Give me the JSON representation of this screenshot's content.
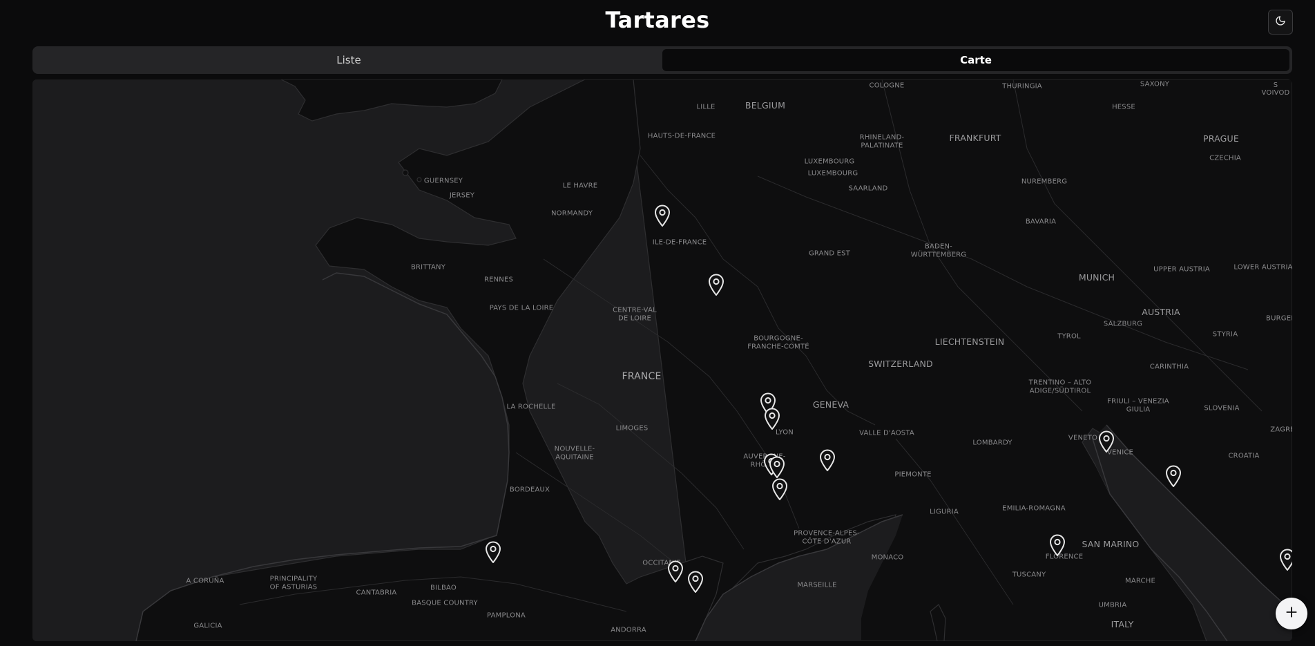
{
  "app": {
    "title": "Tartares"
  },
  "header": {
    "theme_toggle_icon": "moon-icon"
  },
  "tabs": [
    {
      "label": "Liste",
      "active": false
    },
    {
      "label": "Carte",
      "active": true
    }
  ],
  "map": {
    "labels": {
      "cologne": "COLOGNE",
      "thuringia": "THURINGIA",
      "saxony": "SAXONY",
      "lower_saxony": "LOWER S\nVOIVOD",
      "belgium": "BELGIUM",
      "lille": "LILLE",
      "hesse": "HESSE",
      "rhineland_palatinate": "RHINELAND-\nPALATINATE",
      "frankfurt": "FRANKFURT",
      "prague": "PRAGUE",
      "czechia": "CZECHIA",
      "hauts_de_france": "HAUTS-DE-FRANCE",
      "luxembourg_country": "LUXEMBOURG",
      "luxembourg_city": "LUXEMBOURG",
      "saarland": "SAARLAND",
      "nuremberg": "NUREMBERG",
      "guernsey": "GUERNSEY",
      "jersey": "JERSEY",
      "le_havre": "LE HAVRE",
      "normandy": "NORMANDY",
      "bavaria": "BAVARIA",
      "ile_de_france": "ILE-DE-FRANCE",
      "baden_wurttemberg": "BADEN-\nWÜRTTEMBERG",
      "grand_est": "GRAND EST",
      "brittany": "BRITTANY",
      "munich": "MUNICH",
      "upper_austria": "UPPER AUSTRIA",
      "lower_austria": "LOWER AUSTRIA",
      "rennes": "RENNES",
      "pays_de_la_loire": "PAYS DE LA LOIRE",
      "centre_val_de_loire": "CENTRE-VAL\nDE LOIRE",
      "austria": "AUSTRIA",
      "salzburg": "SALZBURG",
      "burgenland": "BURGEN",
      "bourgogne": "BOURGOGNE-\nFRANCHE-COMTÉ",
      "liechtenstein": "LIECHTENSTEIN",
      "tyrol": "TYROL",
      "styria": "STYRIA",
      "switzerland": "SWITZERLAND",
      "carinthia": "CARINTHIA",
      "france": "FRANCE",
      "trentino": "TRENTINO – ALTO\nADIGE/SÜDTIROL",
      "la_rochelle": "LA ROCHELLE",
      "geneva": "GENEVA",
      "friuli": "FRIULI – VENEZIA\nGIULIA",
      "slovenia": "SLOVENIA",
      "limoges": "LIMOGES",
      "lyon": "LYON",
      "valle_d_aosta": "VALLE D'AOSTA",
      "zagreb": "ZAGRE",
      "veneto": "VENETO",
      "venice": "VENICE",
      "nouvelle_aquitaine": "NOUVELLE-\nAQUITAINE",
      "lombardy": "LOMBARDY",
      "croatia": "CROATIA",
      "auvergne": "AUVERGNE-\nRHÔNE-",
      "piemonte": "PIEMONTE",
      "bordeaux": "BORDEAUX",
      "liguria": "LIGURIA",
      "emilia_romagna": "EMILIA-ROMAGNA",
      "provence": "PROVENCE-ALPES-\nCÔTE D'AZUR",
      "san_marino": "SAN MARINO",
      "florence": "FLORENCE",
      "monaco": "MONACO",
      "occitanie": "OCCITANIE",
      "tuscany": "TUSCANY",
      "a_coruna": "A CORUÑA",
      "asturias": "PRINCIPALITY\nOF ASTURIAS",
      "marche": "MARCHE",
      "bilbao": "BILBAO",
      "cantabria": "CANTABRIA",
      "marseille": "MARSEILLE",
      "basque_country": "BASQUE COUNTRY",
      "umbria": "UMBRIA",
      "galicia": "GALICIA",
      "pamplona": "PAMPLONA",
      "italy": "ITALY",
      "andorra": "ANDORRA"
    },
    "marker_icon": "map-pin-icon",
    "marker_count": 15
  },
  "fab": {
    "icon": "plus-icon"
  },
  "colors": {
    "background": "#0b0b0c",
    "land": "#0e0e0f",
    "water": "#1c1c1e",
    "border": "#3a3a3c",
    "pin_stroke": "#e6e6e6",
    "fab_bg": "#f4f4f5"
  }
}
